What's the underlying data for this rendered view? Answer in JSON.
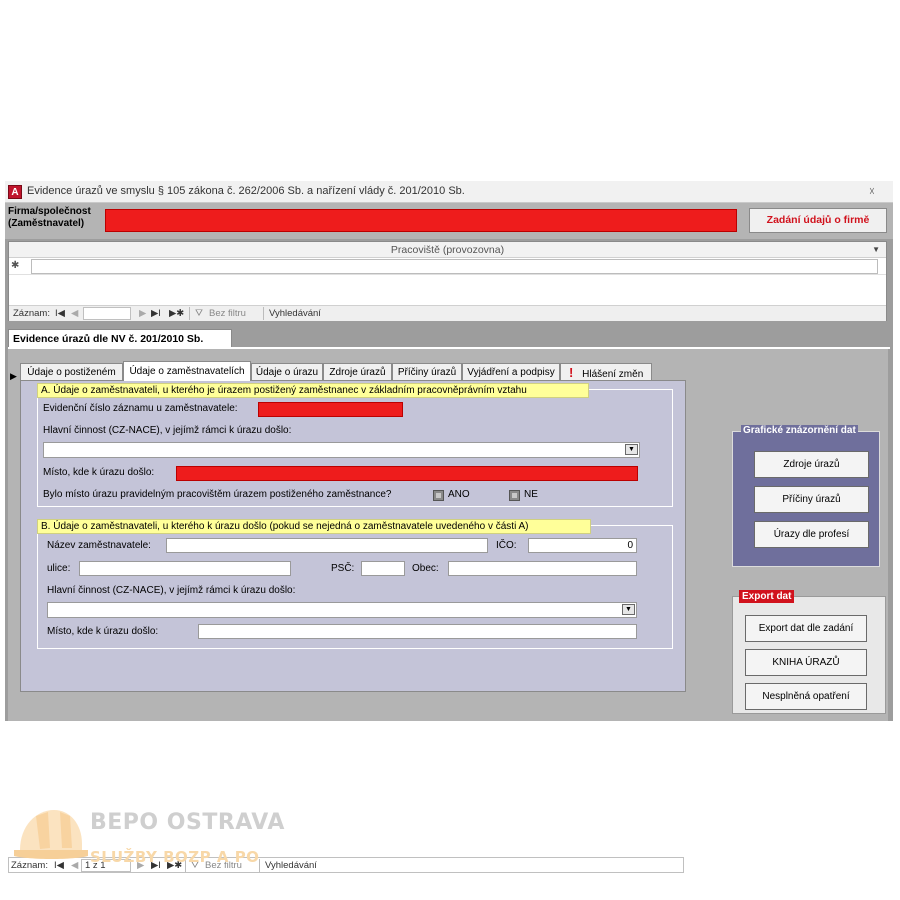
{
  "window": {
    "title": "Evidence úrazů ve smyslu § 105 zákona č. 262/2006 Sb. a nařízení vlády č. 201/2010 Sb.",
    "app_icon": "A",
    "close_glyph": "☓"
  },
  "header": {
    "firm_label_line1": "Firma/společnost",
    "firm_label_line2": "(Zaměstnavatel)",
    "firm_value": "",
    "firm_button": "Zadání údajů o firmě"
  },
  "subform": {
    "column_header": "Pracoviště (provozovna)",
    "new_row_marker": "✱",
    "nav": {
      "label": "Záznam:",
      "first": "I◀",
      "prev": "◀",
      "current": "",
      "next": "▶",
      "last": "▶I",
      "new": "▶✱",
      "filter": "Bez filtru",
      "search": "Vyhledávání"
    }
  },
  "main_tab": "Evidence úrazů dle NV č. 201/2010 Sb.",
  "tabs": [
    {
      "label": "Údaje o postiženém"
    },
    {
      "label": "Údaje o zaměstnavatelích"
    },
    {
      "label": "Údaje o úrazu"
    },
    {
      "label": "Zdroje úrazů"
    },
    {
      "label": "Příčiny úrazů"
    },
    {
      "label": "Vyjádření a podpisy"
    },
    {
      "label": "Hlášení změn",
      "icon": "!"
    }
  ],
  "section_a": {
    "title": "A. Údaje o zaměstnavateli, u kterého je úrazem postižený zaměstnanec v základním pracovněprávním vztahu",
    "record_no_label": "Evidenční číslo záznamu u zaměstnavatele:",
    "activity_label": "Hlavní činnost (CZ-NACE), v jejímž rámci k úrazu došlo:",
    "place_label": "Místo, kde k úrazu došlo:",
    "regular_question": "Bylo místo úrazu pravidelným pracovištěm úrazem postiženého zaměstnance?",
    "yes": "ANO",
    "no": "NE"
  },
  "section_b": {
    "title": "B. Údaje o zaměstnavateli, u kterého k úrazu došlo (pokud se nejedná o zaměstnavatele uvedeného v části A)",
    "name_label": "Název zaměstnavatele:",
    "ico_label": "IČO:",
    "ico_value": "0",
    "street_label": "ulice:",
    "psc_label": "PSČ:",
    "city_label": "Obec:",
    "activity_label": "Hlavní činnost (CZ-NACE), v jejímž rámci k úrazu došlo:",
    "place_label": "Místo, kde k úrazu došlo:"
  },
  "bottom_nav": {
    "label": "Záznam:",
    "first": "I◀",
    "prev": "◀",
    "current": "1 z 1",
    "next": "▶",
    "last": "▶I",
    "new": "▶✱",
    "filter": "Bez filtru",
    "search": "Vyhledávání"
  },
  "graph_panel": {
    "title": "Grafické znázornění dat",
    "buttons": [
      "Zdroje úrazů",
      "Příčiny úrazů",
      "Úrazy dle profesí"
    ]
  },
  "export_panel": {
    "title": "Export dat",
    "buttons": [
      "Export dat dle zadání",
      "KNIHA ÚRAZŮ",
      "Nesplněná opatření"
    ]
  },
  "logo": {
    "name": "BEPO OSTRAVA",
    "subtitle": "SLUŽBY BOZP A PO"
  },
  "colors": {
    "required_field": "#ee1c1c",
    "section_title_bg": "#ffff99",
    "graph_panel_bg": "#6f6f9c",
    "export_title_bg": "#d1121d",
    "window_bg": "#9d9d9d"
  },
  "icons": {
    "app": "access-icon",
    "close": "close-icon",
    "filter": "funnel-icon",
    "warning": "exclamation-icon",
    "combo": "chevron-down-icon",
    "logo": "helmet-icon"
  }
}
